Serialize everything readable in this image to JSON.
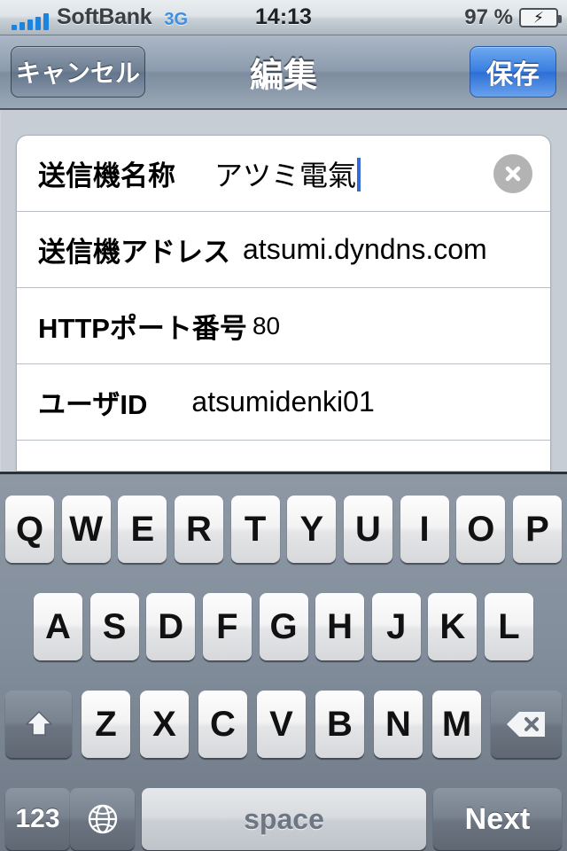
{
  "status_bar": {
    "signal_icon": "signal-bars-icon",
    "signal_bars": 5,
    "carrier": "SoftBank",
    "network": "3G",
    "time": "14:13",
    "battery_percent": "97 %",
    "battery_icon": "battery-charging-icon",
    "charging_glyph": "⚡",
    "accent_blue": "#1a84e0",
    "battery_green": "#5fc314"
  },
  "nav_bar": {
    "cancel_label": "キャンセル",
    "title": "編集",
    "save_label": "保存",
    "save_accent": "#3a7fe0"
  },
  "form": {
    "rows": [
      {
        "label": "送信機名称",
        "value": "アツミ電氣",
        "focused": true,
        "clear_icon": "clear-circle-icon"
      },
      {
        "label": "送信機アドレス",
        "value": "atsumi.dyndns.com",
        "focused": false
      },
      {
        "label": "HTTPポート番号",
        "value": "80",
        "focused": false
      },
      {
        "label": "ユーザID",
        "value": "atsumidenki01",
        "focused": false
      }
    ],
    "caret_color": "#3769d6"
  },
  "keyboard": {
    "row1": [
      "Q",
      "W",
      "E",
      "R",
      "T",
      "Y",
      "U",
      "I",
      "O",
      "P"
    ],
    "row2": [
      "A",
      "S",
      "D",
      "F",
      "G",
      "H",
      "J",
      "K",
      "L"
    ],
    "row3": [
      "Z",
      "X",
      "C",
      "V",
      "B",
      "N",
      "M"
    ],
    "shift_icon": "shift-arrow-icon",
    "backspace_icon": "backspace-icon",
    "numbers_label": "123",
    "globe_icon": "globe-icon",
    "space_label": "space",
    "return_label": "Next"
  }
}
